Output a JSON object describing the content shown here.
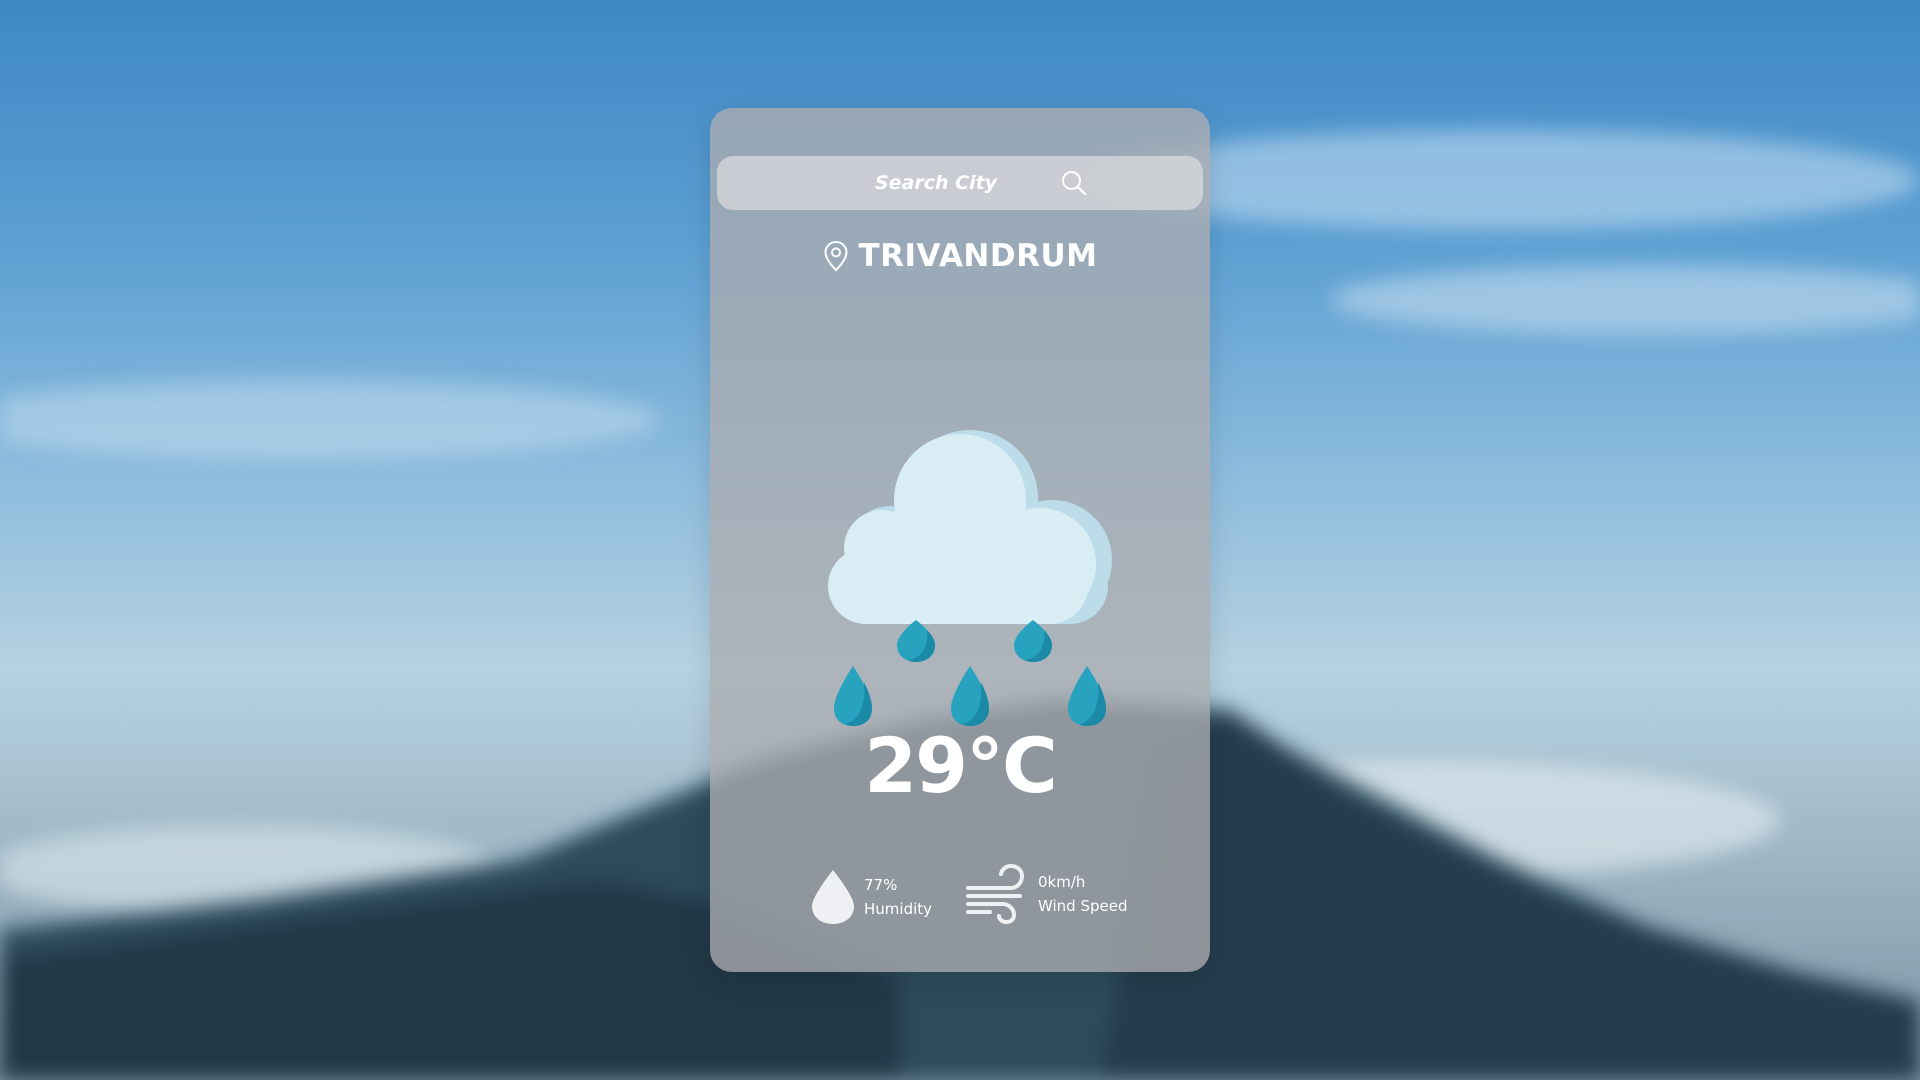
{
  "search": {
    "placeholder": "Search City",
    "value": ""
  },
  "location": {
    "city": "TRIVANDRUM"
  },
  "weather": {
    "condition_icon": "rain-cloud-icon",
    "temperature": "29°C"
  },
  "stats": {
    "humidity": {
      "value": "77%",
      "label": "Humidity",
      "icon": "water-drop-icon"
    },
    "wind": {
      "value": "0km/h",
      "label": "Wind Speed",
      "icon": "wind-icon"
    }
  },
  "colors": {
    "cloud": "#d9eef4",
    "cloud_shadow": "#bcdcea",
    "raindrop": "#27a2bf",
    "raindrop_shadow": "#1b8aa6",
    "card": "#aaacb0",
    "text": "#ffffff"
  }
}
